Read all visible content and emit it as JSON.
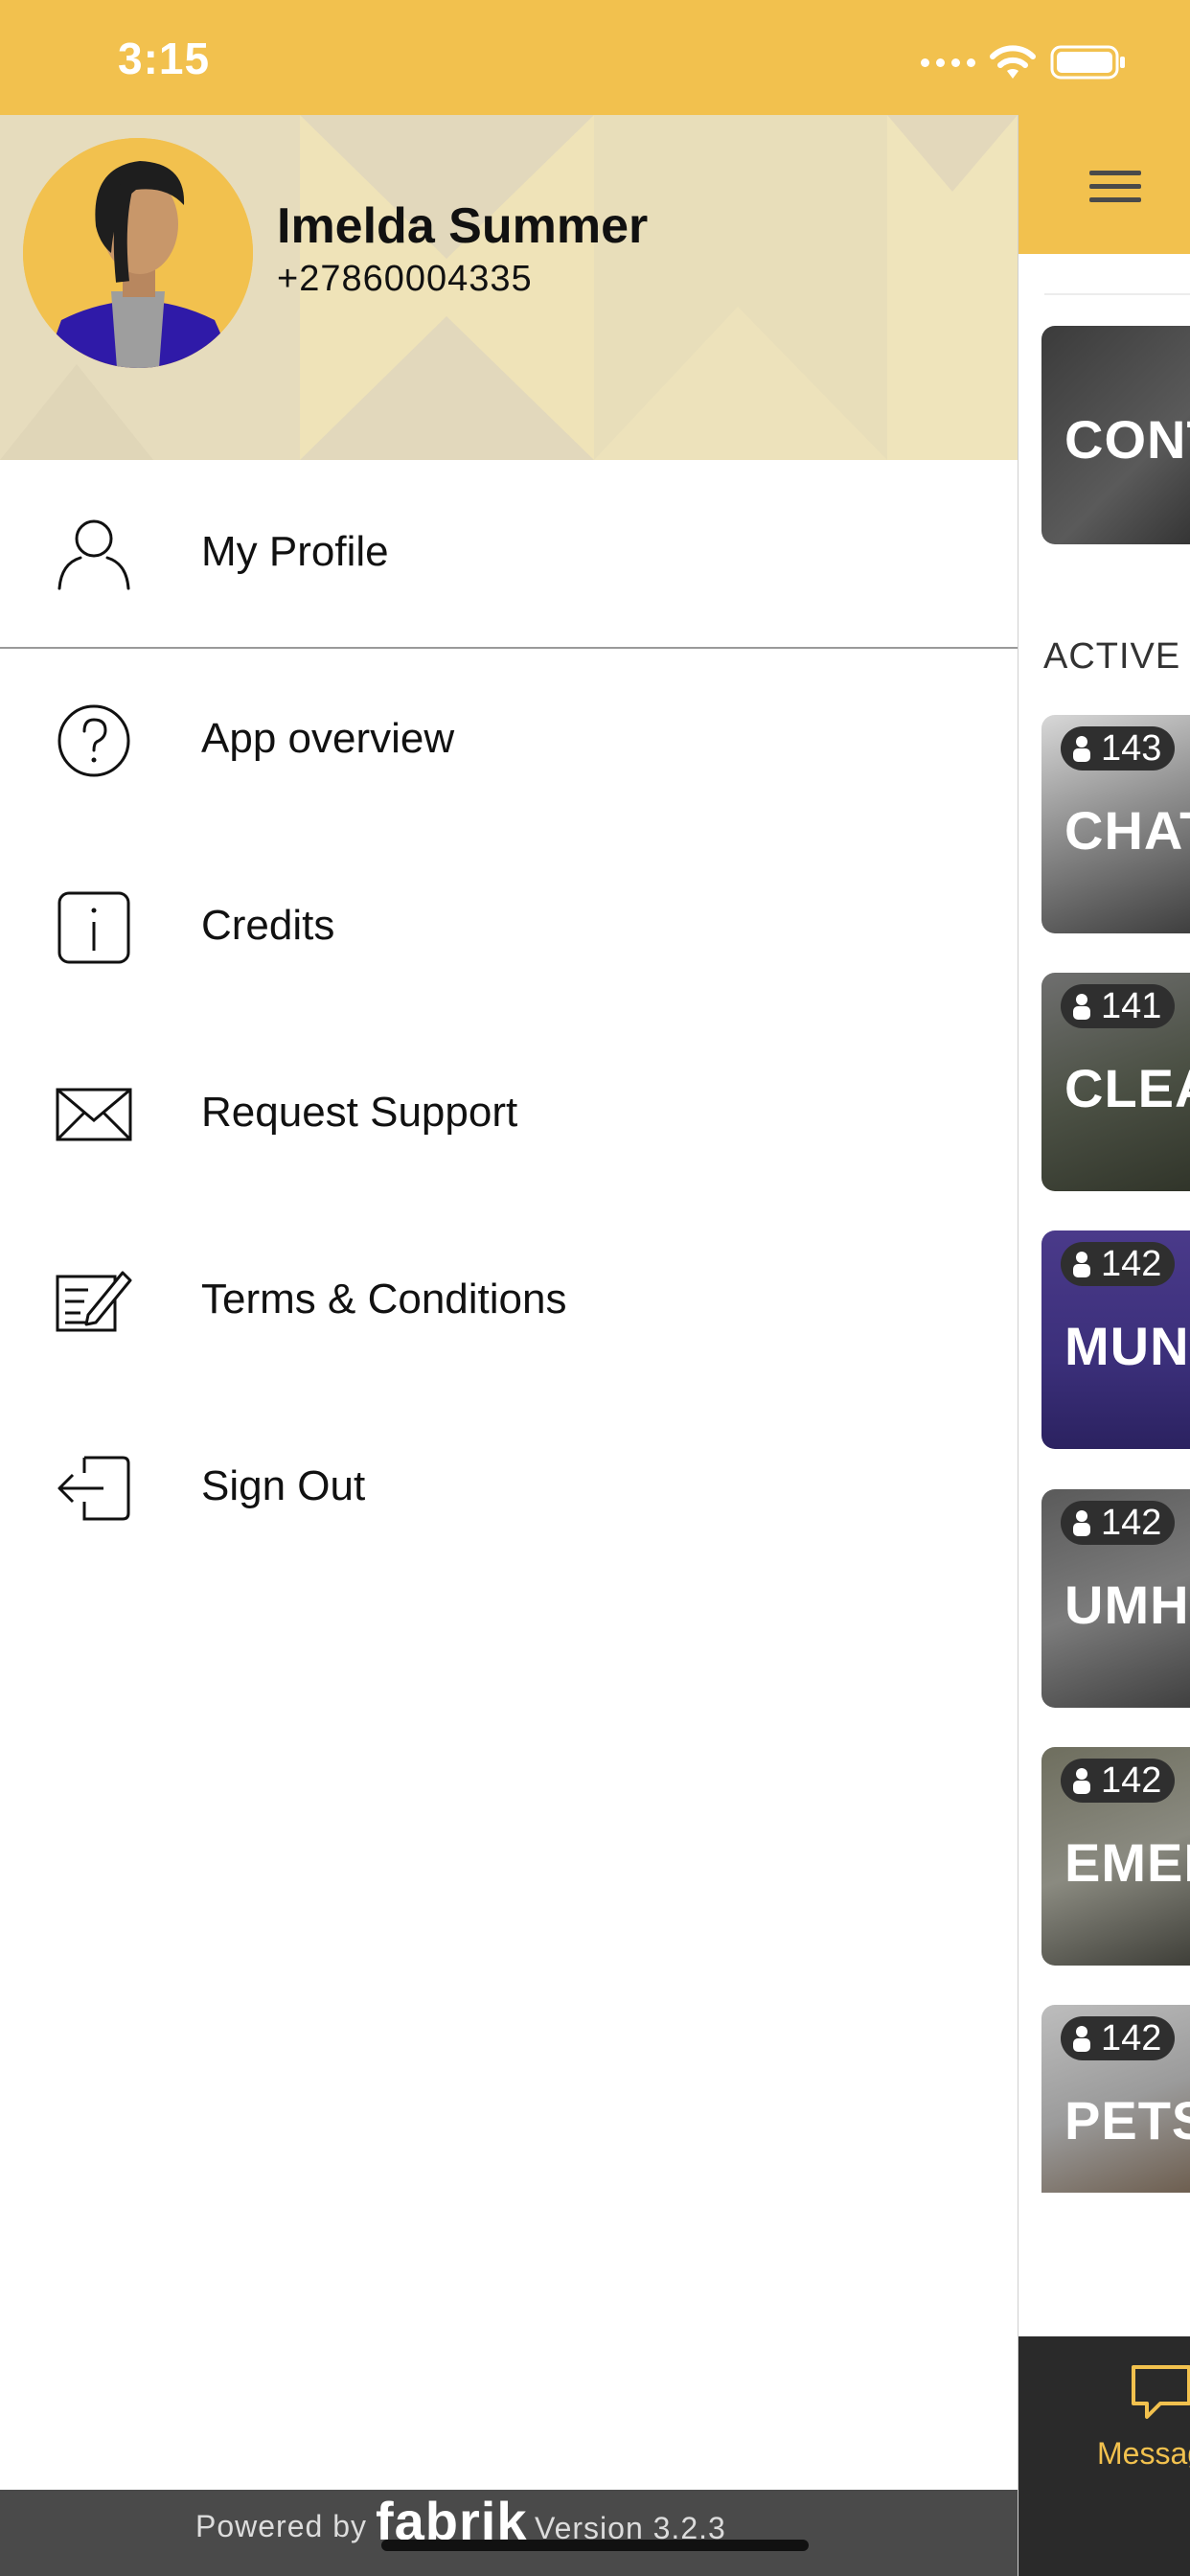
{
  "status_bar": {
    "time": "3:15",
    "signal_icon": "signal-dots-icon",
    "wifi_icon": "wifi-icon",
    "battery_icon": "battery-icon"
  },
  "drawer": {
    "user": {
      "name": "Imelda Summer",
      "phone": "+27860004335",
      "avatar_icon": "user-avatar-illustration"
    },
    "menu": [
      {
        "label": "My Profile",
        "icon": "user-outline-icon"
      },
      {
        "label": "App overview",
        "icon": "question-circle-icon"
      },
      {
        "label": "Credits",
        "icon": "info-icon"
      },
      {
        "label": "Request Support",
        "icon": "envelope-icon"
      },
      {
        "label": "Terms & Conditions",
        "icon": "document-pen-icon"
      },
      {
        "label": "Sign Out",
        "icon": "sign-out-icon"
      }
    ],
    "footer": {
      "powered_by": "Powered by",
      "brand": "fabrik",
      "version": "Version 3.2.3"
    }
  },
  "main": {
    "menu_icon": "hamburger-icon",
    "featured_card": {
      "title": "CONT"
    },
    "section_label": "ACTIVE",
    "channels": [
      {
        "count": "143",
        "title": "CHAT"
      },
      {
        "count": "141",
        "title": "CLEA"
      },
      {
        "count": "142",
        "title": "MUN"
      },
      {
        "count": "142",
        "title": "UMH"
      },
      {
        "count": "142",
        "title": "EMEF"
      },
      {
        "count": "142",
        "title": "PETS"
      }
    ],
    "tab_bar": {
      "active_tab_label": "Messag",
      "active_tab_icon": "chat-bubble-icon"
    }
  },
  "colors": {
    "accent": "#f2c14e",
    "header_bg": "#ece2bf",
    "footer_bg": "#4a4a4a",
    "tabbar_bg": "#2a2a2a",
    "avatar_jacket": "#2f1aa8"
  }
}
